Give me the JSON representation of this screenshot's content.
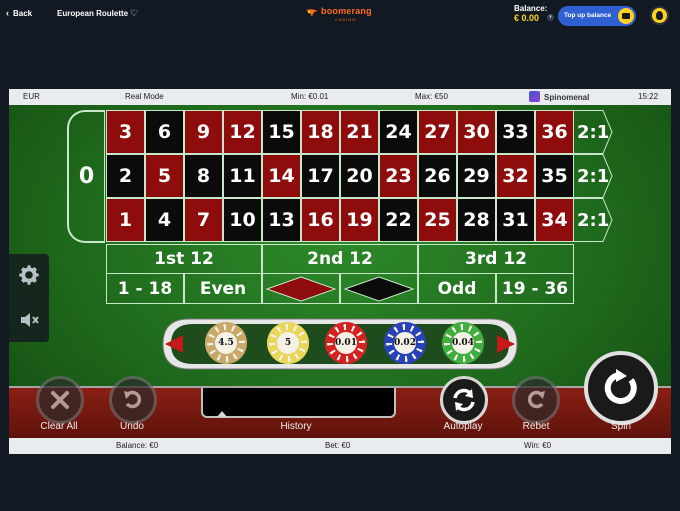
{
  "topbar": {
    "back_label": "Back",
    "game_title": "European Roulette",
    "logo_word": "boomerang",
    "logo_sub": "CASINO",
    "balance_label": "Balance:",
    "balance_value": "€ 0.00",
    "topup_label": "Top up balance"
  },
  "info": {
    "currency": "EUR",
    "mode": "Real Mode",
    "min": "Min: €0.01",
    "max": "Max: €50",
    "provider": "Spinomenal",
    "time": "15:22"
  },
  "table": {
    "zero": "0",
    "rows": [
      [
        {
          "n": "3",
          "c": "red"
        },
        {
          "n": "6",
          "c": "black"
        },
        {
          "n": "9",
          "c": "red"
        },
        {
          "n": "12",
          "c": "red"
        },
        {
          "n": "15",
          "c": "black"
        },
        {
          "n": "18",
          "c": "red"
        },
        {
          "n": "21",
          "c": "red"
        },
        {
          "n": "24",
          "c": "black"
        },
        {
          "n": "27",
          "c": "red"
        },
        {
          "n": "30",
          "c": "red"
        },
        {
          "n": "33",
          "c": "black"
        },
        {
          "n": "36",
          "c": "red"
        }
      ],
      [
        {
          "n": "2",
          "c": "black"
        },
        {
          "n": "5",
          "c": "red"
        },
        {
          "n": "8",
          "c": "black"
        },
        {
          "n": "11",
          "c": "black"
        },
        {
          "n": "14",
          "c": "red"
        },
        {
          "n": "17",
          "c": "black"
        },
        {
          "n": "20",
          "c": "black"
        },
        {
          "n": "23",
          "c": "red"
        },
        {
          "n": "26",
          "c": "black"
        },
        {
          "n": "29",
          "c": "black"
        },
        {
          "n": "32",
          "c": "red"
        },
        {
          "n": "35",
          "c": "black"
        }
      ],
      [
        {
          "n": "1",
          "c": "red"
        },
        {
          "n": "4",
          "c": "black"
        },
        {
          "n": "7",
          "c": "red"
        },
        {
          "n": "10",
          "c": "black"
        },
        {
          "n": "13",
          "c": "black"
        },
        {
          "n": "16",
          "c": "red"
        },
        {
          "n": "19",
          "c": "red"
        },
        {
          "n": "22",
          "c": "black"
        },
        {
          "n": "25",
          "c": "red"
        },
        {
          "n": "28",
          "c": "black"
        },
        {
          "n": "31",
          "c": "black"
        },
        {
          "n": "34",
          "c": "red"
        }
      ]
    ],
    "column_bets": [
      "2:1",
      "2:1",
      "2:1"
    ],
    "dozens": [
      "1st 12",
      "2nd 12",
      "3rd 12"
    ],
    "outside": {
      "low": "1 - 18",
      "even": "Even",
      "odd": "Odd",
      "high": "19 - 36"
    },
    "colors": {
      "red": "#8e0c0c",
      "black": "#0b0b0b",
      "felt": "#1f6a1c"
    }
  },
  "chips": [
    {
      "value": "4.5",
      "color": "#c9a96a"
    },
    {
      "value": "5",
      "color": "#e9d65a"
    },
    {
      "value": "0.01",
      "color": "#d42222"
    },
    {
      "value": "0.02",
      "color": "#2742b8"
    },
    {
      "value": "0.04",
      "color": "#3fae3f"
    }
  ],
  "controls": {
    "clear_all": "Clear All",
    "undo": "Undo",
    "history": "History",
    "autoplay": "Autoplay",
    "rebet": "Rebet",
    "spin": "Spin"
  },
  "status": {
    "balance": "Balance: €0",
    "bet": "Bet: €0",
    "win": "Win: €0"
  },
  "icons": [
    "back-chevron-icon",
    "heart-icon",
    "wallet-icon",
    "user-avatar-icon",
    "settings-gear-icon",
    "sound-muted-icon",
    "clear-x-icon",
    "undo-icon",
    "autoplay-icon",
    "rebet-icon",
    "spin-icon"
  ]
}
